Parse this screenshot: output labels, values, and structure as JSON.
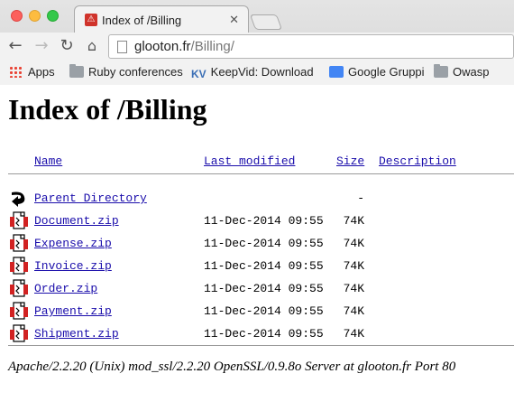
{
  "browser": {
    "tab": {
      "title": "Index of /Billing"
    },
    "address": {
      "host": "glooton.fr",
      "path": "/Billing/"
    },
    "bookmarks": [
      {
        "label": "Apps",
        "icon": "apps-icon"
      },
      {
        "label": "Ruby conferences",
        "icon": "folder-icon"
      },
      {
        "label": "KeepVid: Download",
        "icon": "keepvid-icon"
      },
      {
        "label": "Google Gruppi",
        "icon": "google-groups-icon"
      },
      {
        "label": "Owasp",
        "icon": "folder-icon"
      }
    ]
  },
  "page": {
    "heading": "Index of /Billing",
    "columns": {
      "name": "Name",
      "modified": "Last modified",
      "size": "Size",
      "description": "Description"
    },
    "parent": {
      "name": "Parent Directory",
      "size": "-"
    },
    "files": [
      {
        "name": "Document.zip",
        "modified": "11-Dec-2014 09:55",
        "size": "74K",
        "icon": "zip-file-icon"
      },
      {
        "name": "Expense.zip",
        "modified": "11-Dec-2014 09:55",
        "size": "74K",
        "icon": "zip-file-icon"
      },
      {
        "name": "Invoice.zip",
        "modified": "11-Dec-2014 09:55",
        "size": "74K",
        "icon": "zip-file-icon"
      },
      {
        "name": "Order.zip",
        "modified": "11-Dec-2014 09:55",
        "size": "74K",
        "icon": "zip-file-icon"
      },
      {
        "name": "Payment.zip",
        "modified": "11-Dec-2014 09:55",
        "size": "74K",
        "icon": "zip-file-icon"
      },
      {
        "name": "Shipment.zip",
        "modified": "11-Dec-2014 09:55",
        "size": "74K",
        "icon": "zip-file-icon"
      }
    ],
    "footer": "Apache/2.2.20 (Unix) mod_ssl/2.2.20 OpenSSL/0.9.8o Server at glooton.fr Port 80"
  },
  "colors": {
    "link": "#1a0dab",
    "tab_favicon": "#d0332b"
  }
}
